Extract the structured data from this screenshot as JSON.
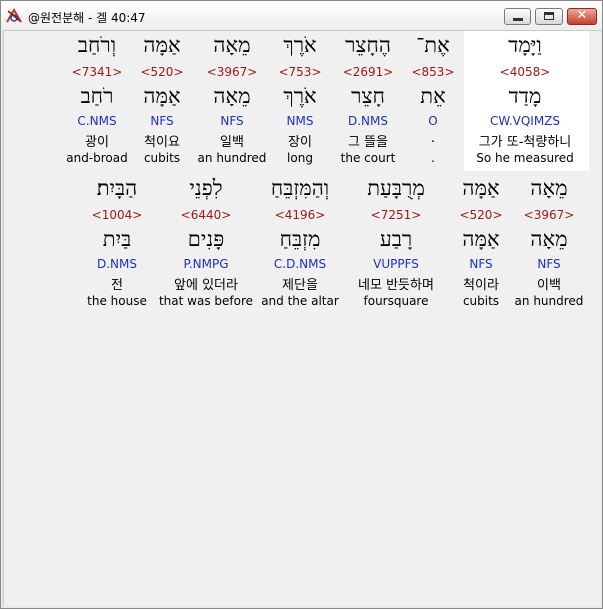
{
  "window": {
    "title": "@원전분해 - 겔 40:47"
  },
  "icons": {
    "app": "app-logo-icon",
    "minimize": "minimize-icon",
    "maximize": "maximize-icon",
    "close": "close-icon"
  },
  "colors": {
    "strong_number": "#a01818",
    "parse_code": "#1f2fbf",
    "highlight_bg": "#ffffff",
    "close_button": "#c8412b"
  },
  "row1": [
    {
      "hebrew": "וַיָּמָד",
      "strong": "<4058>",
      "lemma": "מָדַד",
      "parse": "CW.VQIMZS",
      "korean": "그가 또-척량하니",
      "english": "So he measured"
    },
    {
      "hebrew": "אֶת־",
      "strong": "<853>",
      "lemma": "אֵת",
      "parse": "O",
      "korean": ".",
      "english": "."
    },
    {
      "hebrew": "הֶחָצֵר",
      "strong": "<2691>",
      "lemma": "חָצֵר",
      "parse": "D.NMS",
      "korean": "그 뜰을",
      "english": "the court"
    },
    {
      "hebrew": "אֹרֶךְ",
      "strong": "<753>",
      "lemma": "אֹרֶךְ",
      "parse": "NMS",
      "korean": "장이",
      "english": "long"
    },
    {
      "hebrew": "מֵאָה",
      "strong": "<3967>",
      "lemma": "מֵאָה",
      "parse": "NFS",
      "korean": "일백",
      "english": "an hundred"
    },
    {
      "hebrew": "אַמָּה",
      "strong": "<520>",
      "lemma": "אַמָּה",
      "parse": "NFS",
      "korean": "척이요",
      "english": "cubits"
    },
    {
      "hebrew": "וְרֹחַב",
      "strong": "<7341>",
      "lemma": "רֹחַב",
      "parse": "C.NMS",
      "korean": "광이",
      "english": "and-broad"
    }
  ],
  "row2": [
    {
      "hebrew": "מֵאָה",
      "strong": "<3967>",
      "lemma": "מֵאָה",
      "parse": "NFS",
      "korean": "이백",
      "english": "an hundred"
    },
    {
      "hebrew": "אַמָּה",
      "strong": "<520>",
      "lemma": "אַמָּה",
      "parse": "NFS",
      "korean": "척이라",
      "english": "cubits"
    },
    {
      "hebrew": "מְרֻבָּעַת",
      "strong": "<7251>",
      "lemma": "רָבַע",
      "parse": "VUPPFS",
      "korean": "네모 반듯하며",
      "english": "foursquare"
    },
    {
      "hebrew": "וְהַמִּזְבֵּחַ",
      "strong": "<4196>",
      "lemma": "מִזְבֵּחַ",
      "parse": "C.D.NMS",
      "korean": "제단을",
      "english": "and the altar"
    },
    {
      "hebrew": "לִפְנֵי",
      "strong": "<6440>",
      "lemma": "פָּנִים",
      "parse": "P.NMPG",
      "korean": "앞에 있더라",
      "english": "that was before"
    },
    {
      "hebrew": "הַבָּיִת׃",
      "strong": "<1004>",
      "lemma": "בַּיִת",
      "parse": "D.NMS",
      "korean": "전",
      "english": "the house"
    }
  ]
}
